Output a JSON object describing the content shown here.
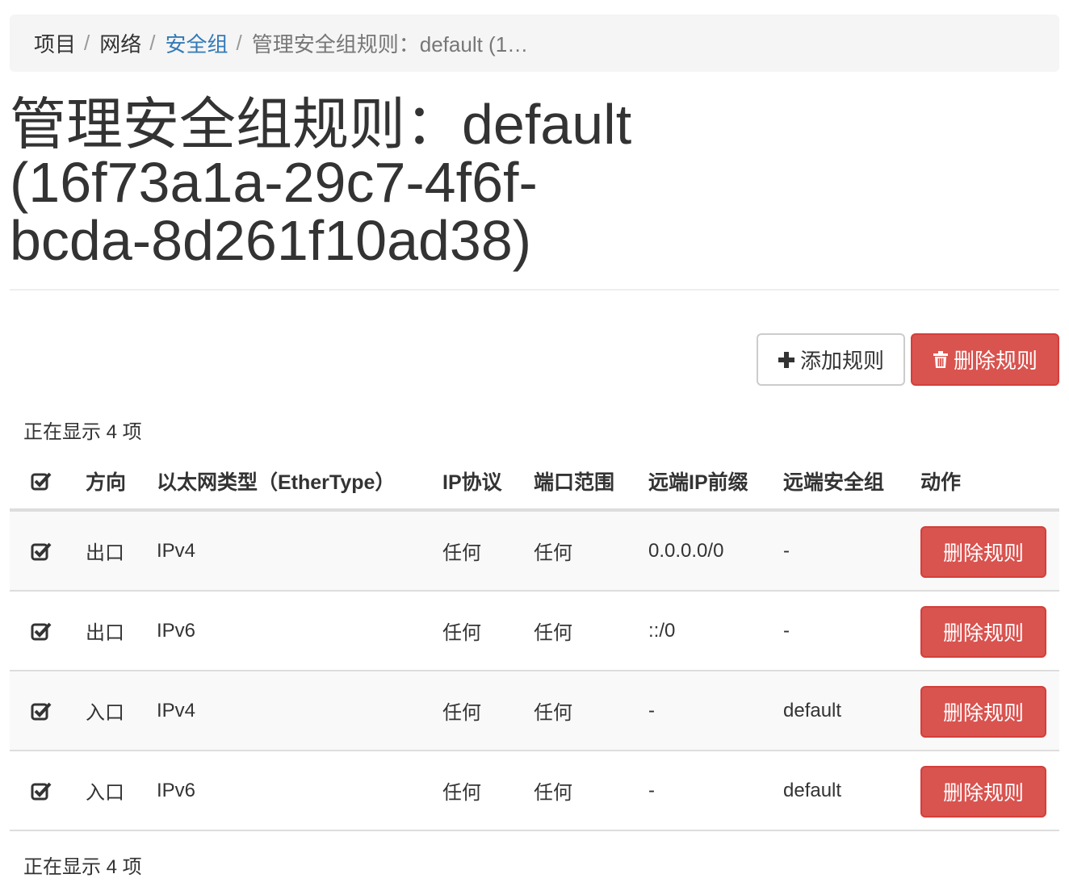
{
  "breadcrumb": {
    "items": [
      "项目",
      "网络",
      "安全组",
      "管理安全组规则：default (1…"
    ],
    "separator": "/"
  },
  "page": {
    "title_line1": "管理安全组规则：default",
    "title_line2": "(16f73a1a-29c7-4f6f-",
    "title_line3": "bcda-8d261f10ad38)"
  },
  "actions": {
    "add_rule": "添加规则",
    "delete_rules": "删除规则"
  },
  "table": {
    "count_text": "正在显示 4 项",
    "columns": [
      "方向",
      "以太网类型（EtherType）",
      "IP协议",
      "端口范围",
      "远端IP前缀",
      "远端安全组",
      "动作"
    ],
    "rows": [
      {
        "direction": "出口",
        "ethertype": "IPv4",
        "protocol": "任何",
        "port_range": "任何",
        "remote_ip": "0.0.0.0/0",
        "remote_group": "-",
        "action": "删除规则"
      },
      {
        "direction": "出口",
        "ethertype": "IPv6",
        "protocol": "任何",
        "port_range": "任何",
        "remote_ip": "::/0",
        "remote_group": "-",
        "action": "删除规则"
      },
      {
        "direction": "入口",
        "ethertype": "IPv4",
        "protocol": "任何",
        "port_range": "任何",
        "remote_ip": "-",
        "remote_group": "default",
        "action": "删除规则"
      },
      {
        "direction": "入口",
        "ethertype": "IPv6",
        "protocol": "任何",
        "port_range": "任何",
        "remote_ip": "-",
        "remote_group": "default",
        "action": "删除规则"
      }
    ]
  },
  "icons": {
    "add": "plus-icon",
    "delete": "trash-icon",
    "checkbox": "checked-checkbox-icon"
  },
  "colors": {
    "danger": "#d9534f",
    "link": "#337ab7",
    "breadcrumb_bg": "#f5f5f5",
    "stripe": "#f9f9f9"
  }
}
